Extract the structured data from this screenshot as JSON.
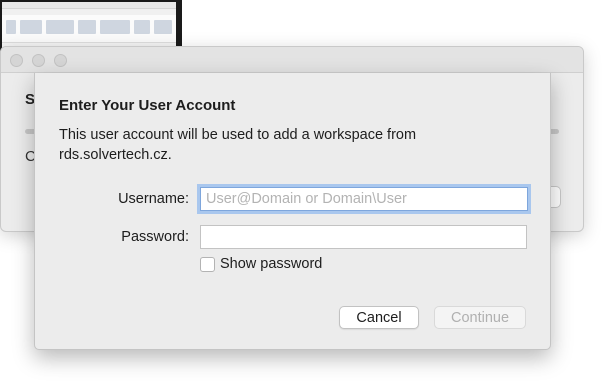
{
  "dialog": {
    "title": "Enter Your User Account",
    "description": "This user account will be used to add a workspace from rds.solvertech.cz.",
    "username_label": "Username:",
    "username_value": "",
    "username_placeholder": "User@Domain or Domain\\User",
    "password_label": "Password:",
    "password_value": "",
    "show_password_label": "Show password",
    "show_password_checked": false,
    "cancel_label": "Cancel",
    "continue_label": "Continue"
  },
  "background_window": {
    "heading_fragment": "S",
    "text_fragment": "C"
  },
  "colors": {
    "focus_ring": "#a9c7ee",
    "sheet_background": "#ececec",
    "disabled_text": "#b0b0b0"
  },
  "icons": [
    "traffic-light-close",
    "traffic-light-minimize",
    "traffic-light-zoom"
  ]
}
